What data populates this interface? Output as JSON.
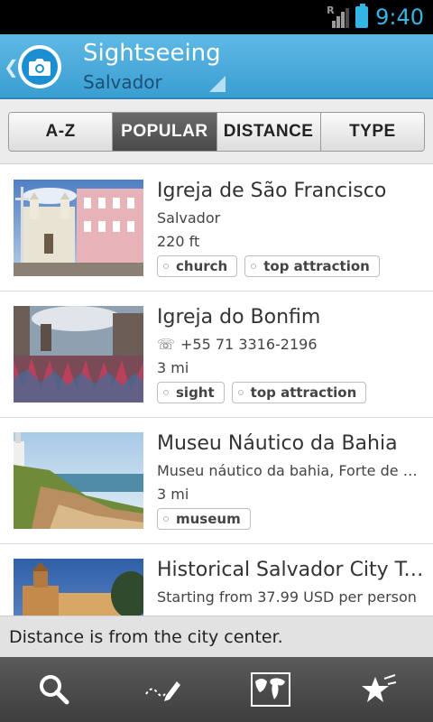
{
  "status_bar": {
    "time": "9:40",
    "signal_label": "R",
    "icons": [
      "signal-icon",
      "battery-icon"
    ]
  },
  "header": {
    "title": "Sightseeing",
    "subtitle": "Salvador",
    "icon": "camera-icon",
    "accent_color": "#3a9ed2"
  },
  "tabs": [
    {
      "label": "A-Z",
      "active": false
    },
    {
      "label": "POPULAR",
      "active": true
    },
    {
      "label": "DISTANCE",
      "active": false
    },
    {
      "label": "TYPE",
      "active": false
    }
  ],
  "places": [
    {
      "name": "Igreja de São Francisco",
      "line1": "Salvador",
      "line1_icon": "",
      "distance": "220 ft",
      "tags": [
        "church",
        "top attraction"
      ]
    },
    {
      "name": "Igreja do Bonfim",
      "line1": "+55 71 3316-2196",
      "line1_icon": "☏",
      "distance": "3 mi",
      "tags": [
        "sight",
        "top attraction"
      ]
    },
    {
      "name": "Museu Náutico da Bahia",
      "line1": "Museu náutico da bahia, Forte de Santo Antônio da Barra",
      "line1_icon": "",
      "distance": "3 mi",
      "tags": [
        "museum"
      ]
    },
    {
      "name": "Historical Salvador City Tour",
      "line1": "Starting from 37.99 USD per person",
      "line1_icon": "",
      "distance": "",
      "tags": []
    }
  ],
  "notice": "Distance is from the city center.",
  "bottom_bar": [
    {
      "icon": "search-icon"
    },
    {
      "icon": "pencil-icon"
    },
    {
      "icon": "map-icon"
    },
    {
      "icon": "star-icon"
    }
  ]
}
